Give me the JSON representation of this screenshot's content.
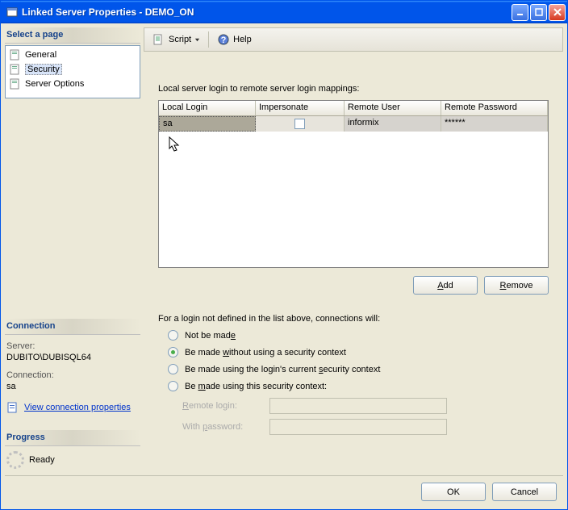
{
  "window": {
    "title": "Linked Server Properties - DEMO_ON"
  },
  "sidebar": {
    "select_page_header": "Select a page",
    "items": [
      {
        "label": "General"
      },
      {
        "label": "Security"
      },
      {
        "label": "Server Options"
      }
    ],
    "connection_header": "Connection",
    "server_label": "Server:",
    "server_value": "DUBITO\\DUBISQL64",
    "connection_label": "Connection:",
    "connection_value": "sa",
    "view_conn_link": "View connection properties",
    "progress_header": "Progress",
    "progress_value": "Ready"
  },
  "toolbar": {
    "script_label": "Script",
    "help_label": "Help"
  },
  "main": {
    "mapping_label": "Local server login to remote server login mappings:",
    "columns": {
      "local_login": "Local Login",
      "impersonate": "Impersonate",
      "remote_user": "Remote User",
      "remote_password": "Remote Password"
    },
    "rows": [
      {
        "local_login": "sa",
        "impersonate": false,
        "remote_user": "informix",
        "remote_password": "******"
      }
    ],
    "add_btn": "Add",
    "remove_btn": "Remove",
    "not_defined_label": "For a login not defined in the list above, connections will:",
    "radios": {
      "not_made": "Not be made",
      "no_ctx": "Be made without using a security context",
      "login_ctx": "Be made using the login's current security context",
      "this_ctx": "Be made using this security context:"
    },
    "selected_radio": "no_ctx",
    "remote_login_label": "Remote login:",
    "with_password_label": "With password:"
  },
  "footer": {
    "ok": "OK",
    "cancel": "Cancel"
  }
}
